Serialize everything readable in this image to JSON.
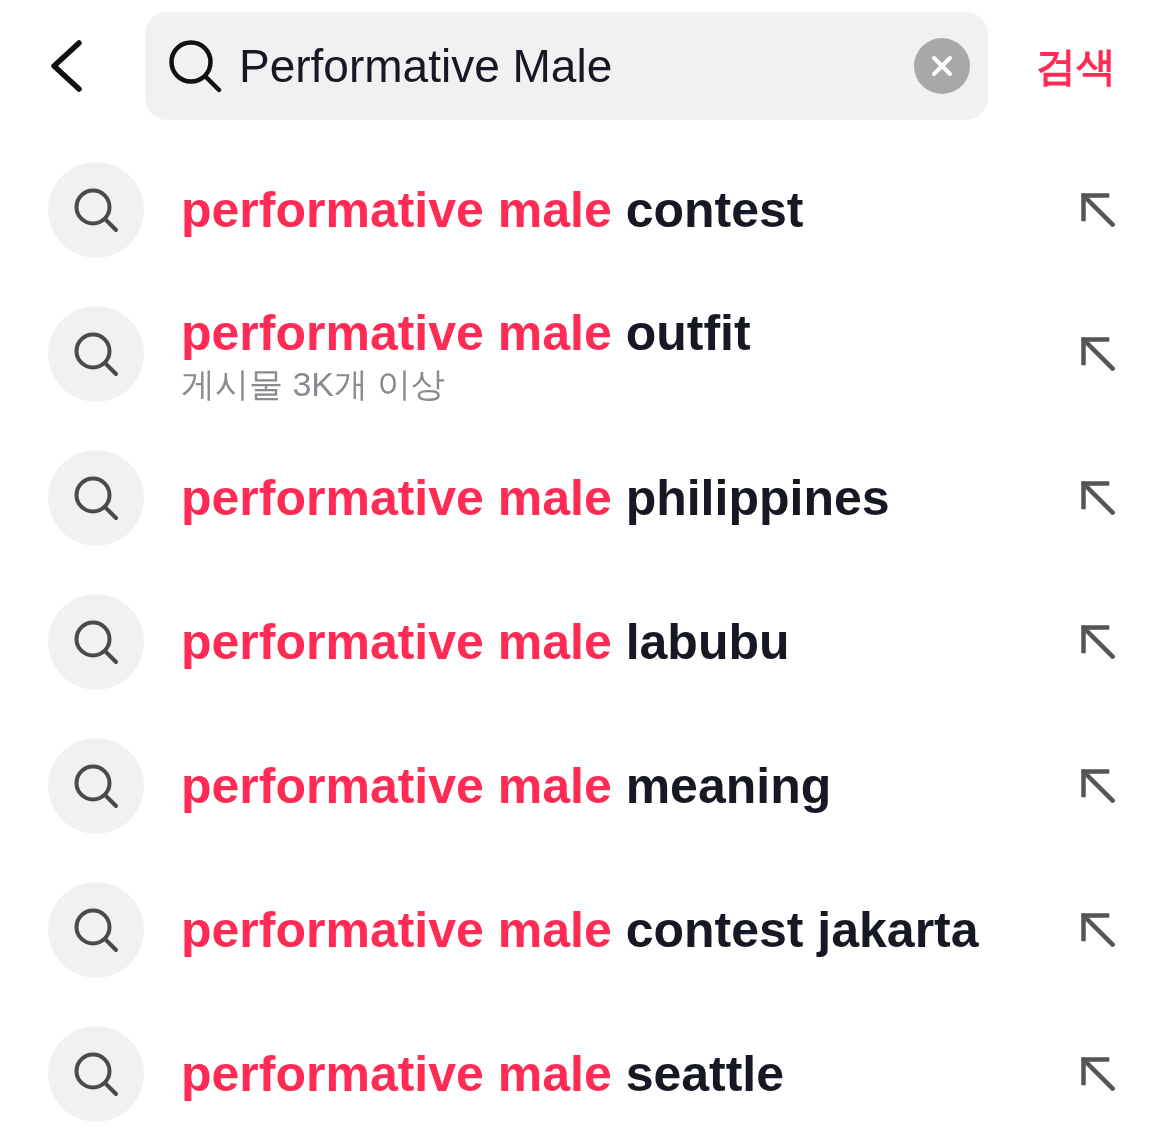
{
  "search": {
    "value": "Performative Male"
  },
  "search_button": {
    "label": "검색"
  },
  "suggestions": [
    {
      "match": "performative male",
      "rest": "contest"
    },
    {
      "match": "performative male",
      "rest": "outfit",
      "meta": "게시물 3K개 이상"
    },
    {
      "match": "performative male",
      "rest": "philippines"
    },
    {
      "match": "performative male",
      "rest": "labubu"
    },
    {
      "match": "performative male",
      "rest": "meaning"
    },
    {
      "match": "performative male",
      "rest": "contest jakarta"
    },
    {
      "match": "performative male",
      "rest": "seattle"
    }
  ]
}
